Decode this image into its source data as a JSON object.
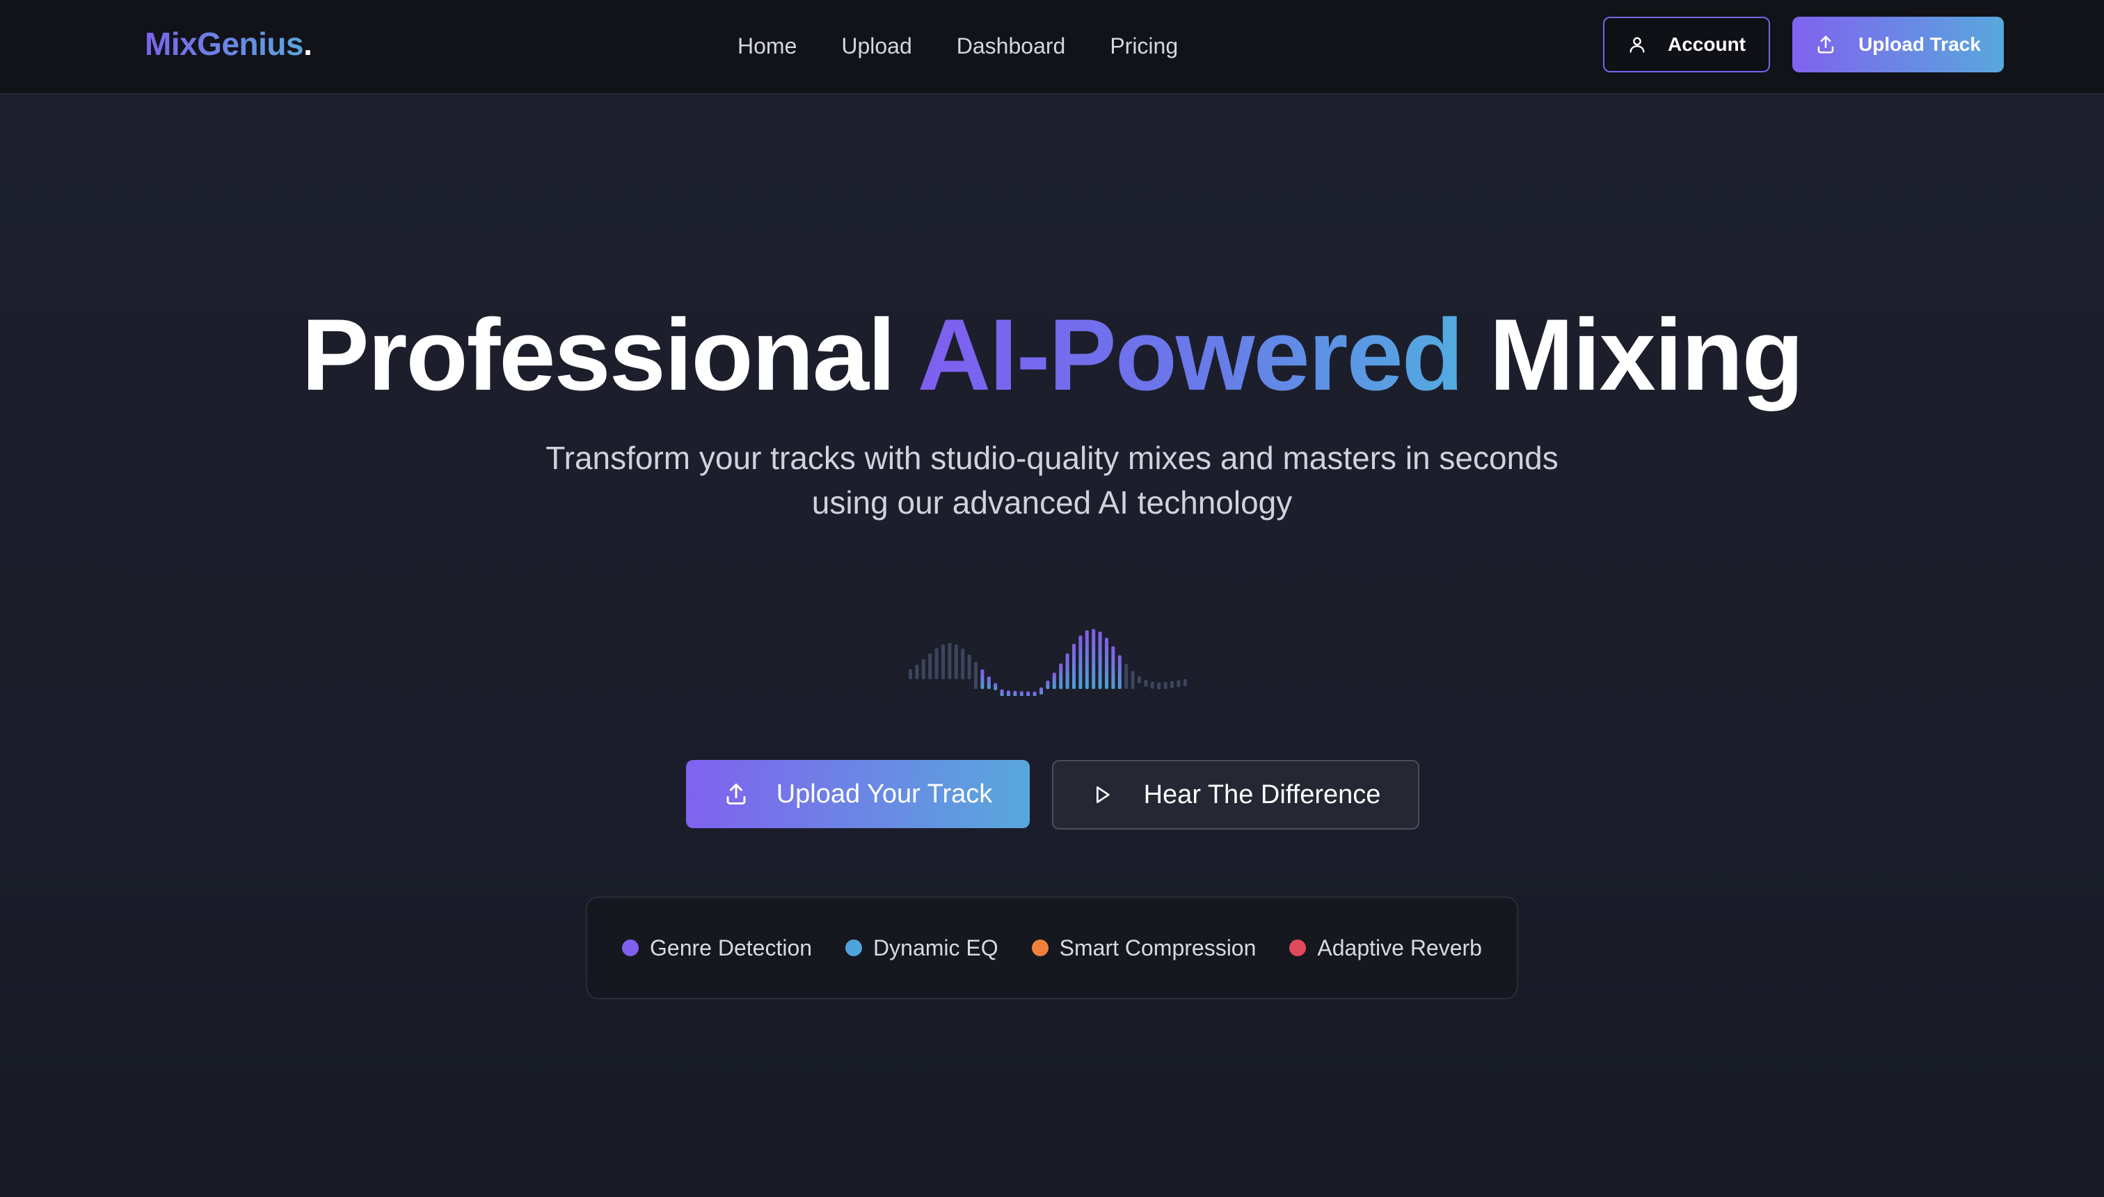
{
  "brand": {
    "name": "MixGenius",
    "dot": "."
  },
  "nav": {
    "links": [
      "Home",
      "Upload",
      "Dashboard",
      "Pricing"
    ],
    "account_label": "Account",
    "account_icon": "user-icon",
    "upload_label": "Upload Track",
    "upload_icon": "upload-icon"
  },
  "hero": {
    "title_before": "Professional ",
    "title_highlight": "AI-Powered",
    "title_after": " Mixing",
    "subtitle_line1": "Transform your tracks with studio-quality mixes and masters in seconds",
    "subtitle_line2": "using our advanced AI technology",
    "primary_cta": "Upload Your Track",
    "primary_icon": "upload-icon",
    "secondary_cta": "Hear The Difference",
    "secondary_icon": "play-icon"
  },
  "features": [
    {
      "label": "Genre Detection",
      "color": "#7f5ff0"
    },
    {
      "label": "Dynamic EQ",
      "color": "#4fa3dc"
    },
    {
      "label": "Smart Compression",
      "color": "#f0803c"
    },
    {
      "label": "Adaptive Reverb",
      "color": "#e04a5a"
    }
  ],
  "colors": {
    "accent_purple": "#7f5ff0",
    "accent_blue": "#52ace0",
    "background": "#1c1f2b",
    "nav_background": "#111319"
  }
}
